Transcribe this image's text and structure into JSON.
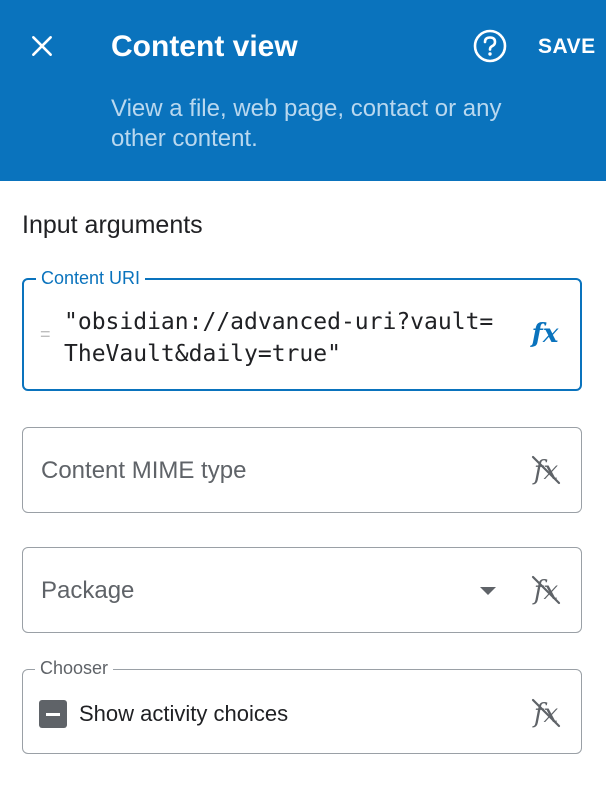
{
  "header": {
    "title": "Content view",
    "save_label": "SAVE",
    "subtitle": "View a file, web page, contact or any other content."
  },
  "section": {
    "heading": "Input arguments"
  },
  "fields": {
    "content_uri": {
      "label": "Content URI",
      "prefix": "=",
      "value": "\"obsidian://advanced-uri?vault=TheVault&daily=true\""
    },
    "mime_type": {
      "placeholder": "Content MIME type"
    },
    "package": {
      "placeholder": "Package"
    },
    "chooser": {
      "label": "Chooser",
      "checkbox_label": "Show activity choices",
      "checkbox_state": "indeterminate"
    }
  },
  "colors": {
    "header_bg": "#0a73bd",
    "accent": "#0a73bd",
    "subtitle_text": "#b9d8ef",
    "border": "#9aa0a6"
  },
  "icons": {
    "close": "close-icon",
    "help": "help-icon",
    "fx_active": "fx-icon",
    "fx_disabled": "fx-off-icon",
    "dropdown": "dropdown-arrow-icon",
    "checkbox": "indeterminate-checkbox-icon"
  }
}
